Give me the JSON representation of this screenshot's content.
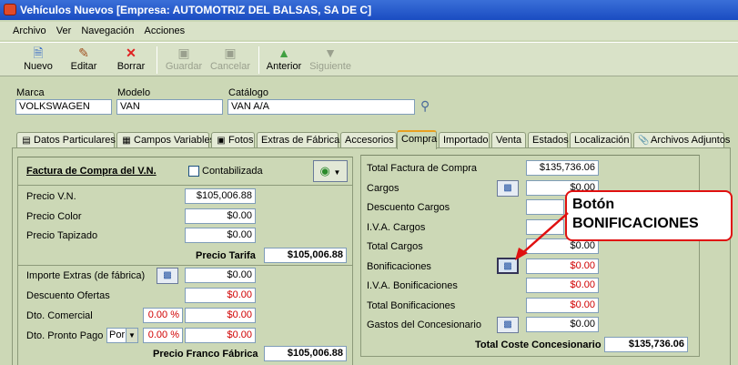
{
  "window": {
    "title": "Vehículos Nuevos [Empresa: AUTOMOTRIZ DEL BALSAS, SA DE C]"
  },
  "menu": [
    "Archivo",
    "Ver",
    "Navegación",
    "Acciones"
  ],
  "toolbar": [
    {
      "label": "Nuevo",
      "icon": "new-document-icon",
      "enabled": true
    },
    {
      "label": "Editar",
      "icon": "edit-icon",
      "enabled": true
    },
    {
      "label": "Borrar",
      "icon": "delete-icon",
      "enabled": true
    },
    {
      "label": "Guardar",
      "icon": "save-icon",
      "enabled": false
    },
    {
      "label": "Cancelar",
      "icon": "cancel-icon",
      "enabled": false
    },
    {
      "label": "Anterior",
      "icon": "up-arrow-icon",
      "enabled": true
    },
    {
      "label": "Siguiente",
      "icon": "down-arrow-icon",
      "enabled": false
    }
  ],
  "vehicle": {
    "marca_label": "Marca",
    "marca": "VOLKSWAGEN",
    "modelo_label": "Modelo",
    "modelo": "VAN",
    "catalogo_label": "Catálogo",
    "catalogo": "VAN A/A"
  },
  "tabs": [
    "Datos Particulares",
    "Campos Variables",
    "Fotos",
    "Extras de Fábrica",
    "Accesorios",
    "Compra",
    "Importado",
    "Venta",
    "Estados",
    "Localización",
    "Archivos Adjuntos"
  ],
  "active_tab": "Compra",
  "left": {
    "title": "Factura de Compra del V.N.",
    "contabilizada": "Contabilizada",
    "precio_vn_label": "Precio V.N.",
    "precio_vn": "$105,006.88",
    "precio_color_label": "Precio Color",
    "precio_color": "$0.00",
    "precio_tapizado_label": "Precio Tapizado",
    "precio_tapizado": "$0.00",
    "precio_tarifa_label": "Precio Tarifa",
    "precio_tarifa": "$105,006.88",
    "importe_extras_label": "Importe Extras (de fábrica)",
    "importe_extras": "$0.00",
    "descuento_ofertas_label": "Descuento Ofertas",
    "descuento_ofertas": "$0.00",
    "dto_comercial_label": "Dto. Comercial",
    "dto_comercial_pct": "0.00 %",
    "dto_comercial": "$0.00",
    "dto_pronto_label": "Dto. Pronto Pago",
    "dto_pronto_sel": "Por",
    "dto_pronto_pct": "0.00 %",
    "dto_pronto": "$0.00",
    "precio_franco_label": "Precio Franco Fábrica",
    "precio_franco": "$105,006.88"
  },
  "right": {
    "total_factura_label": "Total Factura de Compra",
    "total_factura": "$135,736.06",
    "cargos_label": "Cargos",
    "cargos": "$0.00",
    "descuento_cargos_label": "Descuento Cargos",
    "iva_cargos_label": "I.V.A. Cargos",
    "total_cargos_label": "Total Cargos",
    "total_cargos": "$0.00",
    "bonificaciones_label": "Bonificaciones",
    "bonificaciones": "$0.00",
    "iva_bonif_label": "I.V.A. Bonificaciones",
    "iva_bonif": "$0.00",
    "total_bonif_label": "Total Bonificaciones",
    "total_bonif": "$0.00",
    "gastos_label": "Gastos del Concesionario",
    "gastos": "$0.00",
    "total_coste_label": "Total Coste Concesionario",
    "total_coste": "$135,736.06"
  },
  "callout": {
    "line1": "Botón",
    "line2": "BONIFICACIONES"
  },
  "colors": {
    "callout_border": "#e01010",
    "red_value": "#d00000",
    "title_bar": "#1a4cc2"
  }
}
